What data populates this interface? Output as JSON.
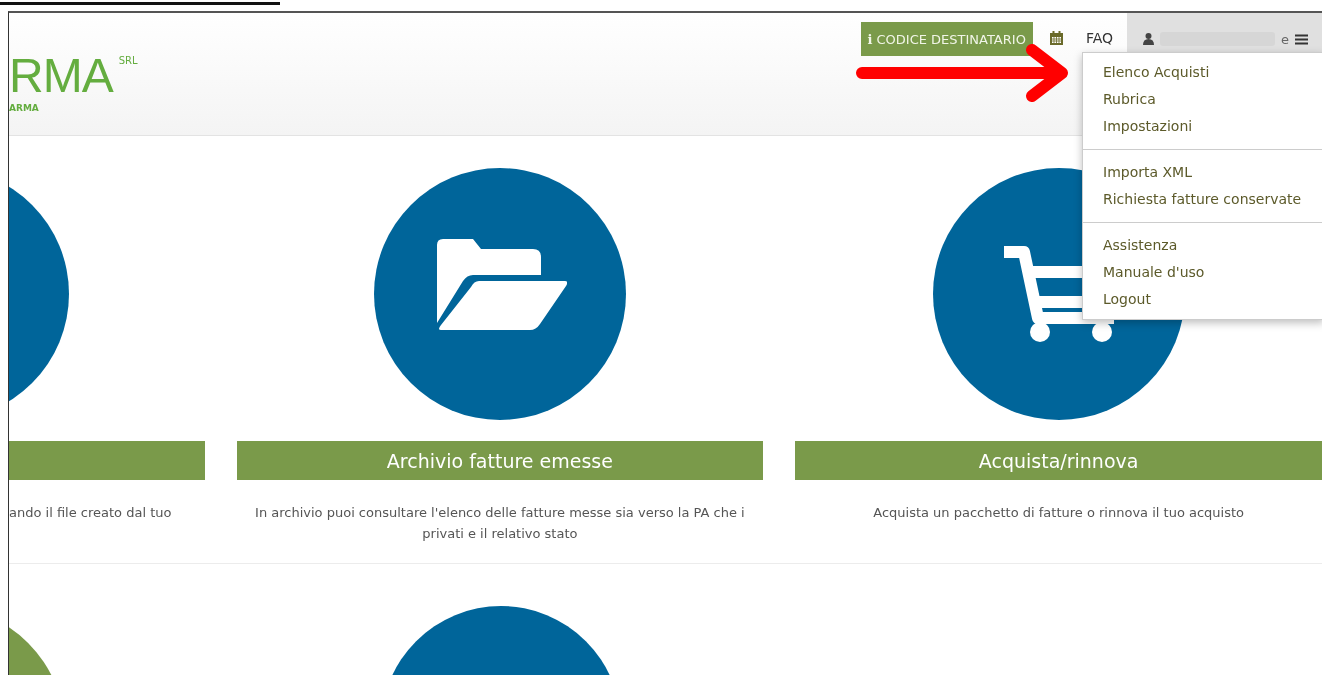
{
  "header": {
    "logo": {
      "text": "RMA",
      "suffix": "SRL",
      "subtitle": "ARMA"
    },
    "nav": {
      "codice_button": {
        "icon": "i",
        "label": "CODICE DESTINATARIO"
      },
      "faq": "FAQ",
      "user": {
        "name_visible": "e",
        "menu_open": true
      }
    }
  },
  "user_menu": {
    "groups": [
      [
        "Elenco Acquisti",
        "Rubrica",
        "Impostazioni"
      ],
      [
        "Importa XML",
        "Richiesta fatture conservate"
      ],
      [
        "Assistenza",
        "Manuale d'uso",
        "Logout"
      ]
    ]
  },
  "tiles": [
    {
      "kind": "cut",
      "description": "ando il file creato dal tuo"
    },
    {
      "kind": "folder",
      "title": "Archivio fatture emesse",
      "description": "In archivio puoi consultare l'elenco delle fatture messe sia verso la PA che i privati e il relativo stato"
    },
    {
      "kind": "cart",
      "title": "Acquista/rinnova",
      "description": "Acquista un pacchetto di fatture o rinnova il tuo acquisto"
    }
  ],
  "tiles_row_2": [
    {
      "kind": "cut",
      "color": "#7a9a4a"
    },
    {
      "kind": "full",
      "color": "#00659a"
    }
  ]
}
